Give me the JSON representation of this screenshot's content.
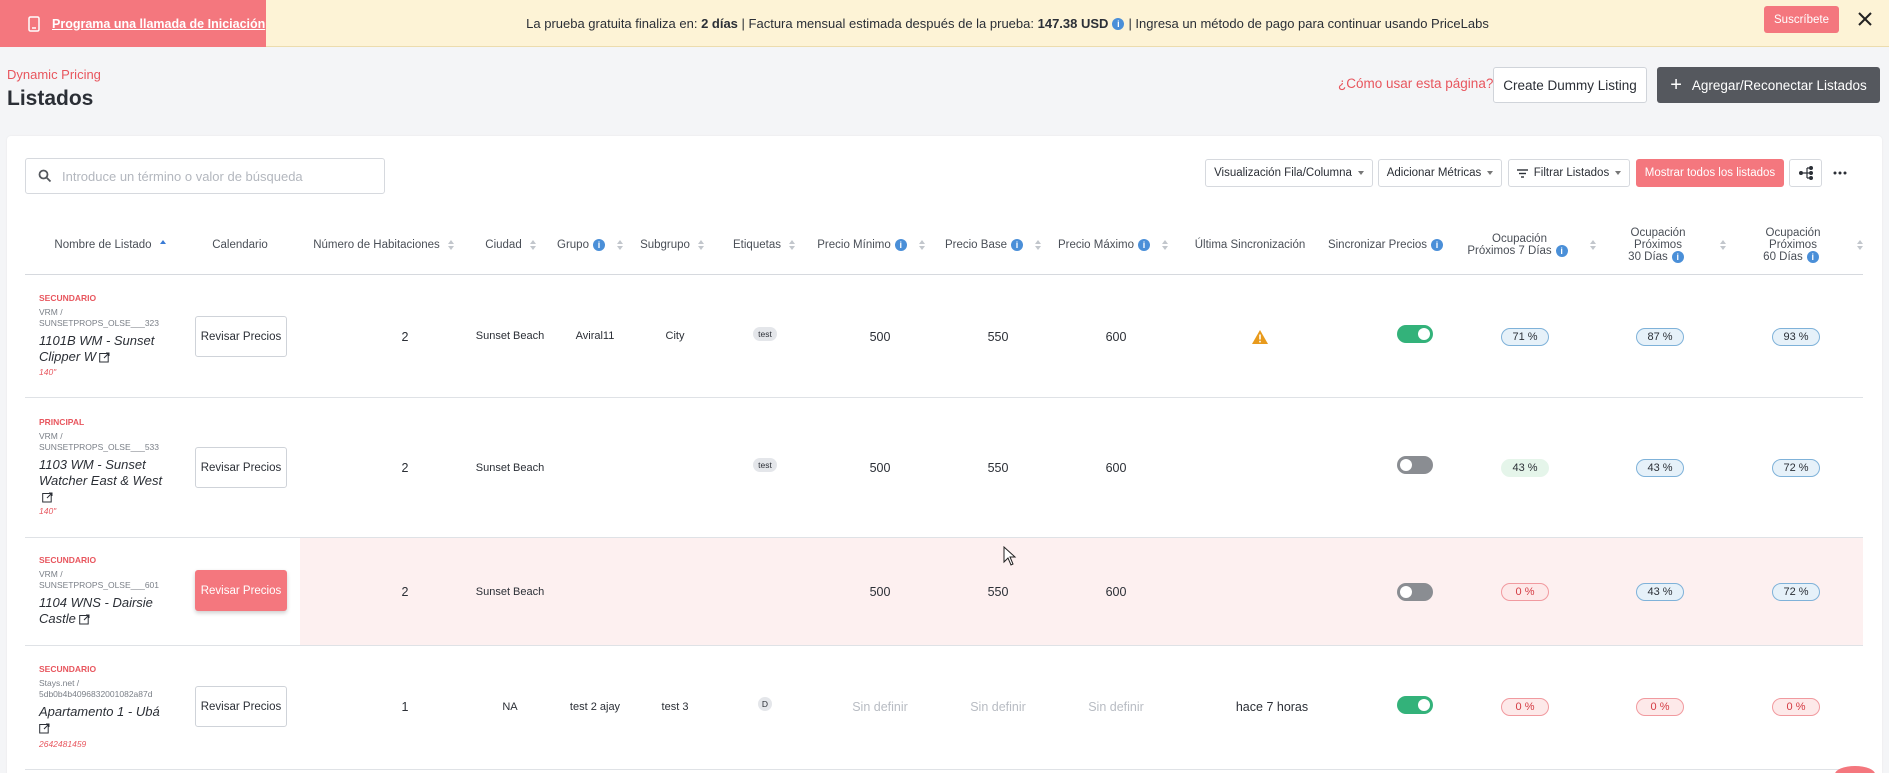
{
  "banner": {
    "cta_label": "Programa una llamada de Iniciación",
    "msg_prefix": "La prueba gratuita finaliza en:",
    "msg_days": "2 días",
    "msg_middle": "| Factura mensual estimada después de la prueba:",
    "msg_amount": "147.38 USD",
    "msg_suffix": "| Ingresa un método de pago para continuar usando PriceLabs",
    "subscribe_label": "Suscríbete"
  },
  "header": {
    "breadcrumb": "Dynamic Pricing",
    "title": "Listados",
    "howto_link": "¿Cómo usar esta página?",
    "dummy_button": "Create Dummy Listing",
    "add_button": "Agregar/Reconectar Listados"
  },
  "toolbar": {
    "search_placeholder": "Introduce un término o valor de búsqueda",
    "view_button": "Visualización Fila/Columna",
    "metrics_button": "Adicionar Métricas",
    "filter_button": "Filtrar Listados",
    "show_all_button": "Mostrar todos los listados"
  },
  "columns": {
    "name": "Nombre de Listado",
    "calendar": "Calendario",
    "rooms": "Número de Habitaciones",
    "city": "Ciudad",
    "group": "Grupo",
    "subgroup": "Subgrupo",
    "tags": "Etiquetas",
    "min_price": "Precio Mínimo",
    "base_price": "Precio Base",
    "max_price": "Precio Máximo",
    "last_sync": "Última Sincronización",
    "sync_prices": "Sincronizar Precios",
    "occ7_l1": "Ocupación",
    "occ7_l2": "Próximos 7 Días",
    "occ30_l1": "Ocupación",
    "occ30_l2": "Próximos",
    "occ30_l3": "30 Días",
    "occ60_l1": "Ocupación",
    "occ60_l2": "Próximos",
    "occ60_l3": "60 Días"
  },
  "review_label": "Revisar Precios",
  "rows": [
    {
      "type": "SECUNDARIO",
      "source_l1": "VRM /",
      "source_l2": "SUNSETPROPS_OLSE___323",
      "name": "1101B WM - Sunset Clipper W",
      "code": "140\"",
      "rooms": "2",
      "city": "Sunset Beach",
      "group": "Aviral11",
      "subgroup": "City",
      "tag": "test",
      "min": "500",
      "base": "550",
      "max": "600",
      "sync": "",
      "sync_on": true,
      "occ7": "71 %",
      "occ30": "87 %",
      "occ60": "93 %"
    },
    {
      "type": "PRINCIPAL",
      "source_l1": "VRM /",
      "source_l2": "SUNSETPROPS_OLSE___533",
      "name": "1103 WM - Sunset Watcher East & West",
      "code": "140\"",
      "rooms": "2",
      "city": "Sunset Beach",
      "group": "",
      "subgroup": "",
      "tag": "test",
      "min": "500",
      "base": "550",
      "max": "600",
      "sync": "",
      "sync_on": false,
      "occ7": "43 %",
      "occ30": "43 %",
      "occ60": "72 %"
    },
    {
      "type": "SECUNDARIO",
      "source_l1": "VRM /",
      "source_l2": "SUNSETPROPS_OLSE___601",
      "name": "1104 WNS - Dairsie Castle",
      "code": "",
      "rooms": "2",
      "city": "Sunset Beach",
      "group": "",
      "subgroup": "",
      "tag": "",
      "min": "500",
      "base": "550",
      "max": "600",
      "sync": "",
      "sync_on": false,
      "occ7": "0 %",
      "occ30": "43 %",
      "occ60": "72 %"
    },
    {
      "type": "SECUNDARIO",
      "source_l1": "Stays.net /",
      "source_l2": "5db0b4b4096832001082a87d",
      "name": "Apartamento 1 - Ubá",
      "code": "2642481459",
      "rooms": "1",
      "city": "NA",
      "group": "test 2 ajay",
      "subgroup": "test 3",
      "tag": "D",
      "min": "Sin definir",
      "base": "Sin definir",
      "max": "Sin definir",
      "sync": "hace 7 horas",
      "sync_on": true,
      "occ7": "0 %",
      "occ30": "0 %",
      "occ60": "0 %"
    }
  ],
  "colors": {
    "accent": "#f4777e",
    "toggle_on": "#33b27a",
    "banner_bg": "#fdf3d6"
  }
}
